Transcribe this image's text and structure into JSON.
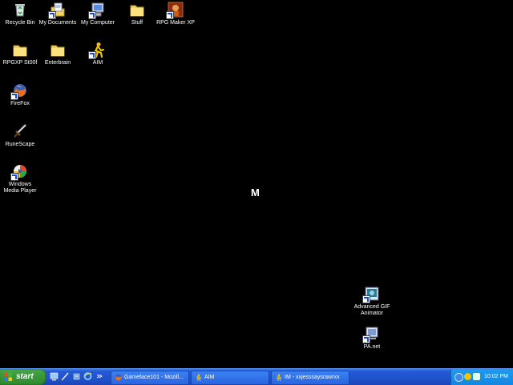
{
  "desktop": {
    "icons": [
      {
        "label": "Recycle Bin",
        "icon": "recycle-bin-icon"
      },
      {
        "label": "My Documents",
        "icon": "my-documents-icon"
      },
      {
        "label": "My Computer",
        "icon": "my-computer-icon"
      },
      {
        "label": "Stuff",
        "icon": "folder-icon"
      },
      {
        "label": "RPG Maker XP",
        "icon": "rpg-maker-icon"
      },
      {
        "label": "RPGXP St00f",
        "icon": "folder-icon"
      },
      {
        "label": "Enterbrain",
        "icon": "folder-icon"
      },
      {
        "label": "AIM",
        "icon": "aim-icon"
      },
      {
        "label": "FireFox",
        "icon": "firefox-icon"
      },
      {
        "label": "RuneScape",
        "icon": "sword-icon"
      },
      {
        "label": "Windows Media Player",
        "icon": "media-player-icon"
      },
      {
        "label": "Advanced GIF Animator",
        "icon": "gif-animator-icon"
      },
      {
        "label": "PA.net",
        "icon": "pa-net-icon"
      }
    ],
    "cursor_text": "M"
  },
  "taskbar": {
    "start_label": "start",
    "quick_launch": [
      "desktop-icon",
      "pen-icon",
      "tool-icon",
      "ie-icon",
      "expand-arrow-icon"
    ],
    "buttons": [
      {
        "label": "Gameface101 - Mozill...",
        "icon": "firefox-icon"
      },
      {
        "label": "AIM",
        "icon": "aim-icon"
      },
      {
        "label": "IM - xxjesssaysrawrxx",
        "icon": "aim-icon"
      }
    ],
    "clock": "10:02 PM"
  },
  "colors": {
    "desktop_bg": "#000000",
    "taskbar_blue": "#2459d6",
    "start_green": "#3a9a3a",
    "tray_blue": "#1487e0"
  }
}
